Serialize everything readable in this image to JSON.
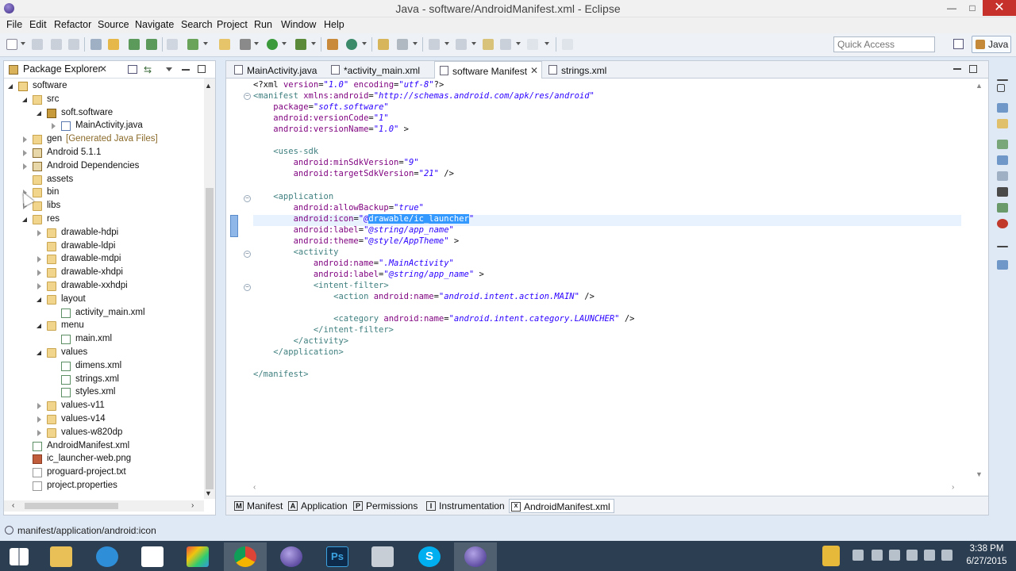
{
  "window": {
    "title": "Java - software/AndroidManifest.xml - Eclipse",
    "minimize": "—",
    "maximize": "□",
    "close": "✕"
  },
  "menu": [
    "File",
    "Edit",
    "Refactor",
    "Source",
    "Navigate",
    "Search",
    "Project",
    "Run",
    "Window",
    "Help"
  ],
  "toolbar": {
    "quick_access_placeholder": "Quick Access",
    "perspective": "Java"
  },
  "package_explorer": {
    "title": "Package Explorer",
    "tree": [
      {
        "label": "software",
        "icon": "project-icon",
        "expanded": true,
        "depth": 0
      },
      {
        "label": "src",
        "icon": "source-folder-icon",
        "expanded": true,
        "depth": 1
      },
      {
        "label": "soft.software",
        "icon": "package-icon",
        "expanded": true,
        "depth": 2
      },
      {
        "label": "MainActivity.java",
        "icon": "java-file-icon",
        "expanded": false,
        "depth": 3
      },
      {
        "label": "gen",
        "suffix": "[Generated Java Files]",
        "icon": "source-folder-icon",
        "expanded": false,
        "depth": 1
      },
      {
        "label": "Android 5.1.1",
        "icon": "library-icon",
        "expanded": false,
        "depth": 1
      },
      {
        "label": "Android Dependencies",
        "icon": "library-icon",
        "expanded": false,
        "depth": 1
      },
      {
        "label": "assets",
        "icon": "folder-icon",
        "expanded": null,
        "depth": 1
      },
      {
        "label": "bin",
        "icon": "folder-icon",
        "expanded": false,
        "depth": 1
      },
      {
        "label": "libs",
        "icon": "folder-icon",
        "expanded": false,
        "depth": 1
      },
      {
        "label": "res",
        "icon": "folder-icon",
        "expanded": true,
        "depth": 1
      },
      {
        "label": "drawable-hdpi",
        "icon": "folder-icon",
        "expanded": false,
        "depth": 2
      },
      {
        "label": "drawable-ldpi",
        "icon": "folder-icon",
        "expanded": null,
        "depth": 2
      },
      {
        "label": "drawable-mdpi",
        "icon": "folder-icon",
        "expanded": false,
        "depth": 2
      },
      {
        "label": "drawable-xhdpi",
        "icon": "folder-icon",
        "expanded": false,
        "depth": 2
      },
      {
        "label": "drawable-xxhdpi",
        "icon": "folder-icon",
        "expanded": false,
        "depth": 2
      },
      {
        "label": "layout",
        "icon": "folder-icon",
        "expanded": true,
        "depth": 2
      },
      {
        "label": "activity_main.xml",
        "icon": "xml-file-icon",
        "expanded": null,
        "depth": 3
      },
      {
        "label": "menu",
        "icon": "folder-icon",
        "expanded": true,
        "depth": 2
      },
      {
        "label": "main.xml",
        "icon": "xml-file-icon",
        "expanded": null,
        "depth": 3
      },
      {
        "label": "values",
        "icon": "folder-icon",
        "expanded": true,
        "depth": 2
      },
      {
        "label": "dimens.xml",
        "icon": "xml-file-icon",
        "expanded": null,
        "depth": 3
      },
      {
        "label": "strings.xml",
        "icon": "xml-file-icon",
        "expanded": null,
        "depth": 3
      },
      {
        "label": "styles.xml",
        "icon": "xml-file-icon",
        "expanded": null,
        "depth": 3
      },
      {
        "label": "values-v11",
        "icon": "folder-icon",
        "expanded": false,
        "depth": 2
      },
      {
        "label": "values-v14",
        "icon": "folder-icon",
        "expanded": false,
        "depth": 2
      },
      {
        "label": "values-w820dp",
        "icon": "folder-icon",
        "expanded": false,
        "depth": 2
      },
      {
        "label": "AndroidManifest.xml",
        "icon": "manifest-file-icon",
        "expanded": null,
        "depth": 1
      },
      {
        "label": "ic_launcher-web.png",
        "icon": "image-file-icon",
        "expanded": null,
        "depth": 1
      },
      {
        "label": "proguard-project.txt",
        "icon": "text-file-icon",
        "expanded": null,
        "depth": 1
      },
      {
        "label": "project.properties",
        "icon": "text-file-icon",
        "expanded": null,
        "depth": 1
      }
    ]
  },
  "editor": {
    "tabs": [
      {
        "label": "MainActivity.java",
        "active": false
      },
      {
        "label": "*activity_main.xml",
        "active": false
      },
      {
        "label": "software Manifest",
        "active": true
      },
      {
        "label": "strings.xml",
        "active": false
      }
    ],
    "code_lines": [
      [
        [
          "p",
          "<?xml "
        ],
        [
          "a",
          "version"
        ],
        [
          "p",
          "="
        ],
        [
          "v",
          "\"1.0\""
        ],
        [
          "p",
          " "
        ],
        [
          "a",
          "encoding"
        ],
        [
          "p",
          "="
        ],
        [
          "v",
          "\"utf-8\""
        ],
        [
          "p",
          "?>"
        ]
      ],
      [
        [
          "t",
          "<manifest "
        ],
        [
          "a",
          "xmlns:android"
        ],
        [
          "p",
          "="
        ],
        [
          "v",
          "\"http://schemas.android.com/apk/res/android\""
        ]
      ],
      [
        [
          "p",
          "    "
        ],
        [
          "a",
          "package"
        ],
        [
          "p",
          "="
        ],
        [
          "v",
          "\"soft.software\""
        ]
      ],
      [
        [
          "p",
          "    "
        ],
        [
          "a",
          "android:versionCode"
        ],
        [
          "p",
          "="
        ],
        [
          "v",
          "\"1\""
        ]
      ],
      [
        [
          "p",
          "    "
        ],
        [
          "a",
          "android:versionName"
        ],
        [
          "p",
          "="
        ],
        [
          "v",
          "\"1.0\""
        ],
        [
          "p",
          " >"
        ]
      ],
      [
        [
          "p",
          ""
        ]
      ],
      [
        [
          "t",
          "    <uses-sdk"
        ]
      ],
      [
        [
          "p",
          "        "
        ],
        [
          "a",
          "android:minSdkVersion"
        ],
        [
          "p",
          "="
        ],
        [
          "v",
          "\"9\""
        ]
      ],
      [
        [
          "p",
          "        "
        ],
        [
          "a",
          "android:targetSdkVersion"
        ],
        [
          "p",
          "="
        ],
        [
          "v",
          "\"21\""
        ],
        [
          "p",
          " />"
        ]
      ],
      [
        [
          "p",
          ""
        ]
      ],
      [
        [
          "t",
          "    <application"
        ]
      ],
      [
        [
          "p",
          "        "
        ],
        [
          "a",
          "android:allowBackup"
        ],
        [
          "p",
          "="
        ],
        [
          "v",
          "\"true\""
        ]
      ],
      [
        [
          "p",
          "        "
        ],
        [
          "a",
          "android:icon"
        ],
        [
          "p",
          "="
        ],
        [
          "v",
          "\"@"
        ],
        [
          "s",
          "drawable/ic_launcher"
        ],
        [
          "v",
          "\""
        ]
      ],
      [
        [
          "p",
          "        "
        ],
        [
          "a",
          "android:label"
        ],
        [
          "p",
          "="
        ],
        [
          "v",
          "\"@string/app_name\""
        ]
      ],
      [
        [
          "p",
          "        "
        ],
        [
          "a",
          "android:theme"
        ],
        [
          "p",
          "="
        ],
        [
          "v",
          "\"@style/AppTheme\""
        ],
        [
          "p",
          " >"
        ]
      ],
      [
        [
          "t",
          "        <activity"
        ]
      ],
      [
        [
          "p",
          "            "
        ],
        [
          "a",
          "android:name"
        ],
        [
          "p",
          "="
        ],
        [
          "v",
          "\".MainActivity\""
        ]
      ],
      [
        [
          "p",
          "            "
        ],
        [
          "a",
          "android:label"
        ],
        [
          "p",
          "="
        ],
        [
          "v",
          "\"@string/app_name\""
        ],
        [
          "p",
          " >"
        ]
      ],
      [
        [
          "t",
          "            <intent-filter>"
        ]
      ],
      [
        [
          "t",
          "                <action "
        ],
        [
          "a",
          "android:name"
        ],
        [
          "p",
          "="
        ],
        [
          "v",
          "\"android.intent.action.MAIN\""
        ],
        [
          "p",
          " />"
        ]
      ],
      [
        [
          "p",
          ""
        ]
      ],
      [
        [
          "t",
          "                <category "
        ],
        [
          "a",
          "android:name"
        ],
        [
          "p",
          "="
        ],
        [
          "v",
          "\"android.intent.category.LAUNCHER\""
        ],
        [
          "p",
          " />"
        ]
      ],
      [
        [
          "t",
          "            </intent-filter>"
        ]
      ],
      [
        [
          "t",
          "        </activity>"
        ]
      ],
      [
        [
          "t",
          "    </application>"
        ]
      ],
      [
        [
          "p",
          ""
        ]
      ],
      [
        [
          "t",
          "</manifest>"
        ]
      ]
    ],
    "bottom_tabs": [
      {
        "label": "Manifest",
        "icon": "M",
        "active": false
      },
      {
        "label": "Application",
        "icon": "A",
        "active": false
      },
      {
        "label": "Permissions",
        "icon": "P",
        "active": false
      },
      {
        "label": "Instrumentation",
        "icon": "I",
        "active": false
      },
      {
        "label": "AndroidManifest.xml",
        "icon": "X",
        "active": true
      }
    ]
  },
  "status": {
    "text": "manifest/application/android:icon"
  },
  "taskbar": {
    "items": [
      "windows-start-icon",
      "file-explorer-icon",
      "internet-explorer-icon",
      "dropbox-icon",
      "paint-icon",
      "chrome-icon",
      "eclipse-icon",
      "photoshop-icon",
      "camera-icon",
      "skype-icon",
      "eclipse-icon"
    ],
    "time": "3:38 PM",
    "date": "6/27/2015"
  },
  "colors": {
    "tag": "#3f7f7f",
    "attr": "#7f007f",
    "value": "#2a00ff",
    "selection": "#3399ff"
  }
}
